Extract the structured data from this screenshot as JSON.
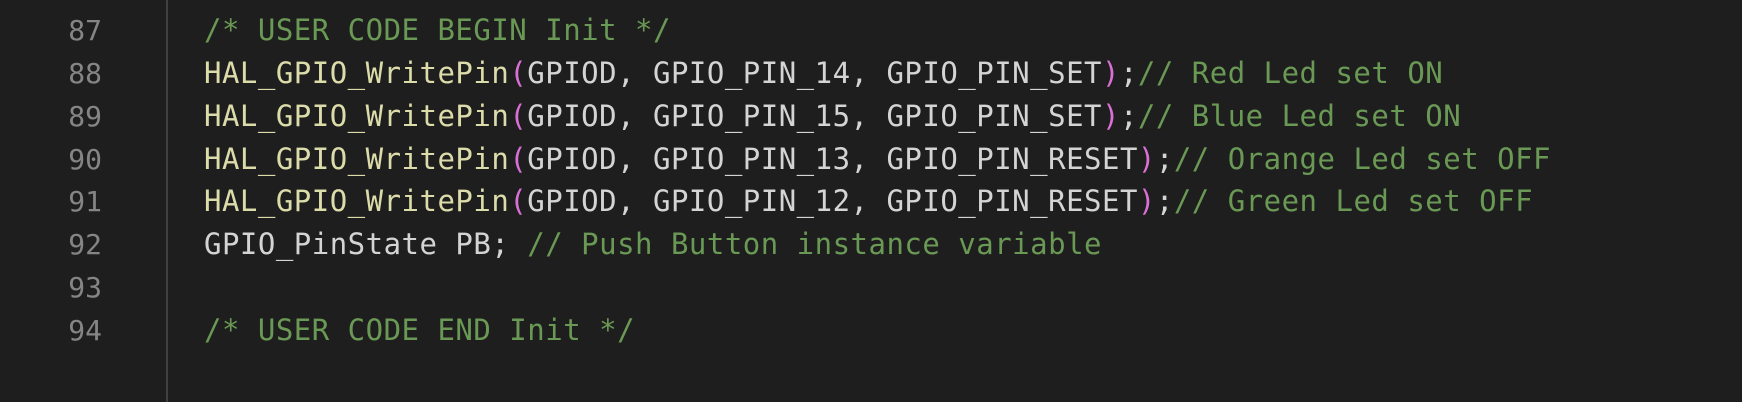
{
  "colors": {
    "background": "#1e1e1e",
    "line_number": "#858585",
    "function": "#dcdcaa",
    "paren": "#da70d6",
    "text": "#d4d4d4",
    "comment": "#6a9955"
  },
  "lines": [
    {
      "number": "87",
      "comment": "/* USER CODE BEGIN Init */"
    },
    {
      "number": "88",
      "fn": "HAL_GPIO_WritePin",
      "open": "(",
      "args": "GPIOD, GPIO_PIN_14, GPIO_PIN_SET",
      "close": ")",
      "semi": ";",
      "comment": "// Red Led set ON"
    },
    {
      "number": "89",
      "fn": "HAL_GPIO_WritePin",
      "open": "(",
      "args": "GPIOD, GPIO_PIN_15, GPIO_PIN_SET",
      "close": ")",
      "semi": ";",
      "comment": "// Blue Led set ON"
    },
    {
      "number": "90",
      "fn": "HAL_GPIO_WritePin",
      "open": "(",
      "args": "GPIOD, GPIO_PIN_13, GPIO_PIN_RESET",
      "close": ")",
      "semi": ";",
      "comment": "// Orange Led set OFF"
    },
    {
      "number": "91",
      "fn": "HAL_GPIO_WritePin",
      "open": "(",
      "args": "GPIOD, GPIO_PIN_12, GPIO_PIN_RESET",
      "close": ")",
      "semi": ";",
      "comment": "// Green Led set OFF"
    },
    {
      "number": "92",
      "code": "GPIO_PinState PB; ",
      "comment": "// Push Button instance variable"
    },
    {
      "number": "93"
    },
    {
      "number": "94",
      "comment": "/* USER CODE END Init */"
    }
  ]
}
